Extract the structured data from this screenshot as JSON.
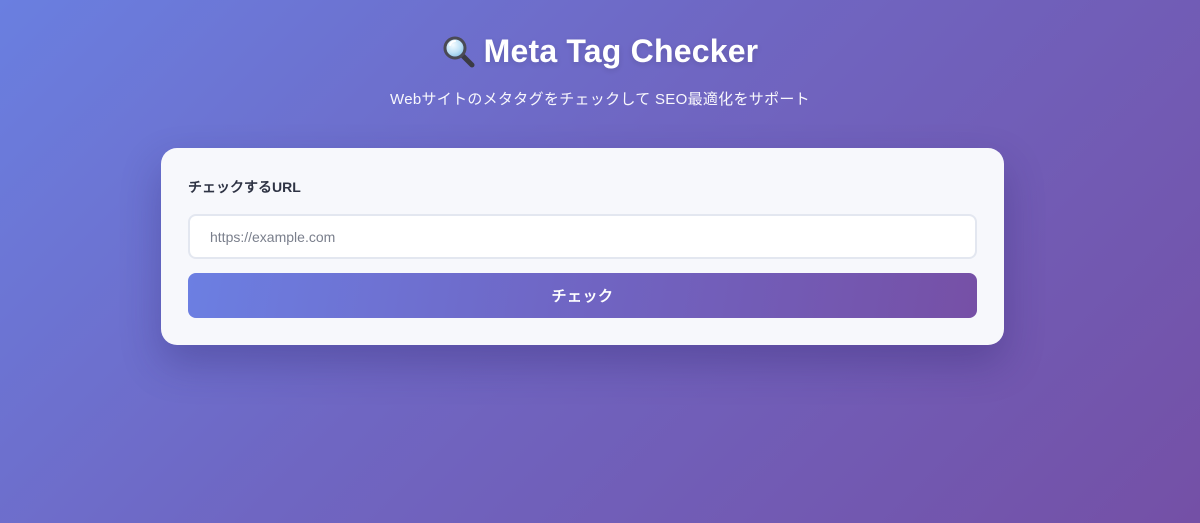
{
  "header": {
    "icon": "magnifying-glass-icon",
    "title": "Meta Tag Checker",
    "subtitle": "Webサイトのメタタグをチェックして SEO最適化をサポート"
  },
  "form": {
    "url_label": "チェックするURL",
    "url_placeholder": "https://example.com",
    "url_value": "",
    "submit_label": "チェック"
  },
  "colors": {
    "background_start": "#6a7fe0",
    "background_end": "#7450a6",
    "card_background": "#f7f8fc",
    "label_text": "#2e3344",
    "button_gradient_start": "#6c7fe2",
    "button_gradient_end": "#7650a6"
  }
}
